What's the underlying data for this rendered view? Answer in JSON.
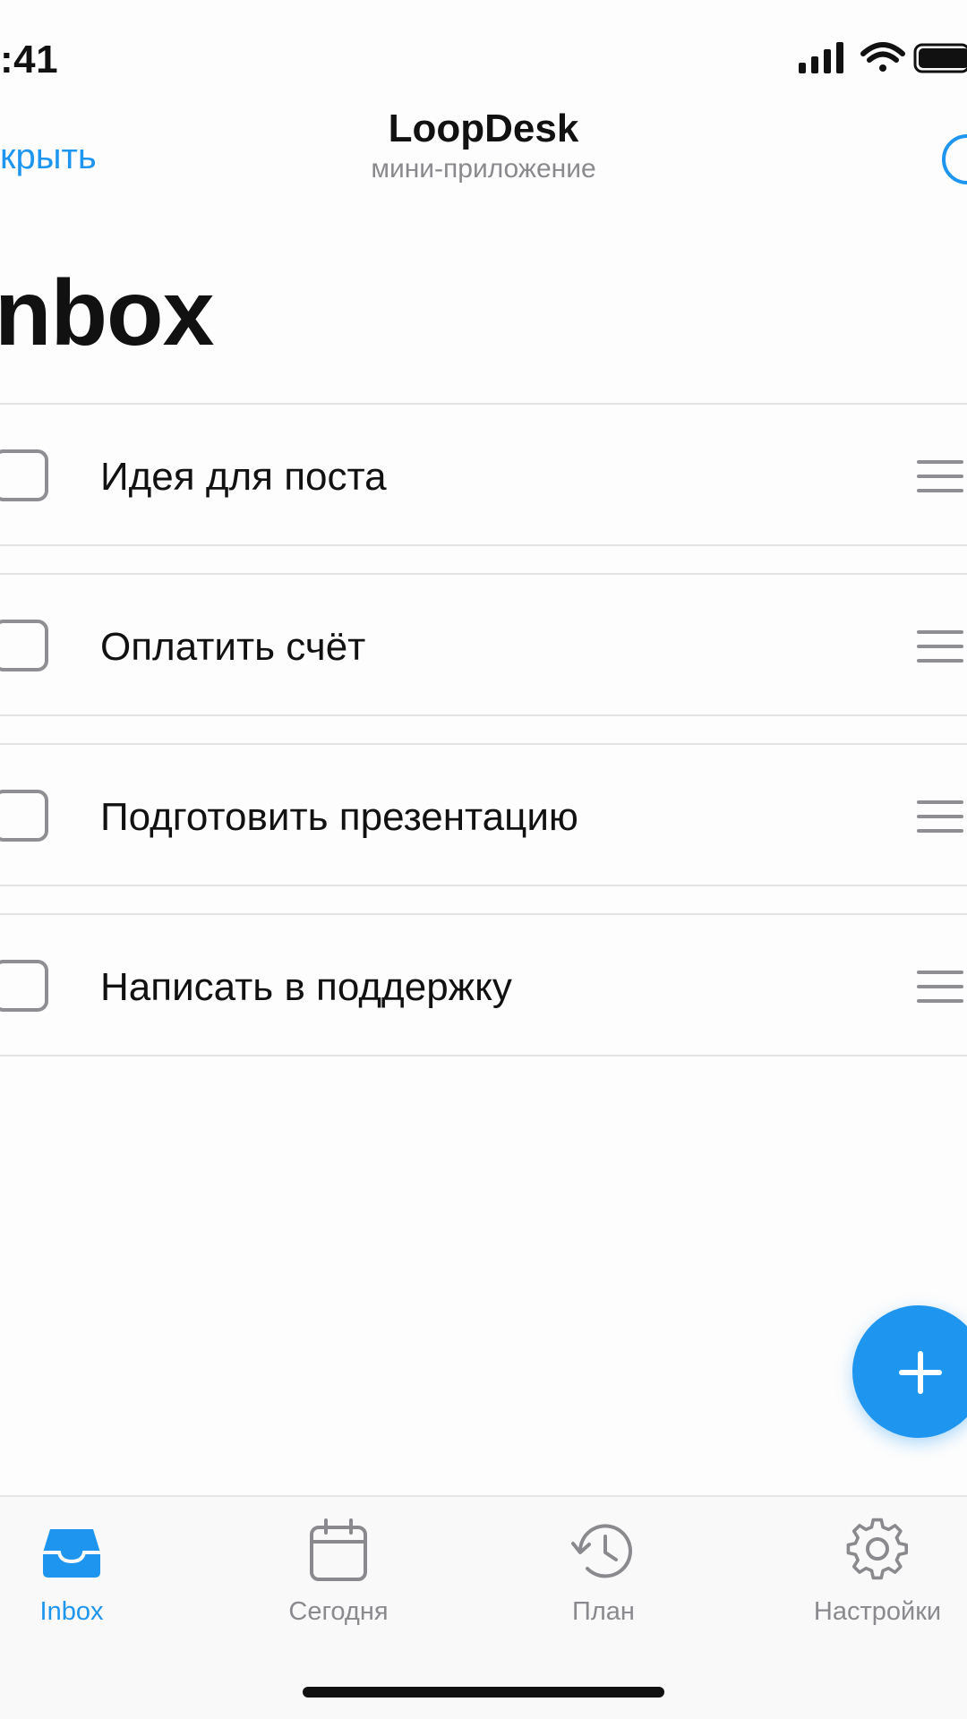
{
  "status_bar": {
    "time": ":41",
    "icons": [
      "signal-icon",
      "wifi-icon",
      "battery-icon"
    ]
  },
  "nav": {
    "close_label": "крыть",
    "title": "LoopDesk",
    "subtitle": "мини-приложение",
    "more_icon": "more-icon"
  },
  "page": {
    "title": "nbox"
  },
  "tasks": [
    {
      "label": "Идея для поста",
      "checked": false
    },
    {
      "label": "Оплатить счёт",
      "checked": false
    },
    {
      "label": "Подготовить презентацию",
      "checked": false
    },
    {
      "label": "Написать в поддержку",
      "checked": false
    }
  ],
  "fab": {
    "icon": "plus-icon"
  },
  "tabbar": {
    "items": [
      {
        "label": "Inbox",
        "icon": "inbox-icon",
        "active": true
      },
      {
        "label": "Сегодня",
        "icon": "calendar-icon",
        "active": false
      },
      {
        "label": "План",
        "icon": "history-icon",
        "active": false
      },
      {
        "label": "Настройки",
        "icon": "gear-icon",
        "active": false
      }
    ]
  },
  "colors": {
    "accent": "#1e96f0",
    "text": "#111111",
    "secondary": "#8a8a8e",
    "divider": "#e3e3e6"
  }
}
